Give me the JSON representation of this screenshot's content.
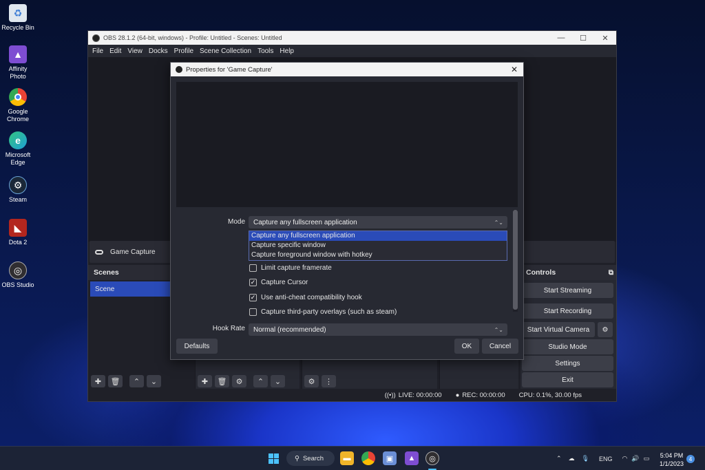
{
  "desktop": {
    "icons": [
      {
        "label": "Recycle Bin",
        "icon": "recycle-bin-icon",
        "color": "#dfe7ef"
      },
      {
        "label": "Affinity Photo",
        "icon": "affinity-photo-icon",
        "color": "#7e4dd2"
      },
      {
        "label": "Google Chrome",
        "icon": "chrome-icon",
        "color": "#e84335"
      },
      {
        "label": "Microsoft Edge",
        "icon": "edge-icon",
        "color": "#1fa0d6"
      },
      {
        "label": "Steam",
        "icon": "steam-icon",
        "color": "#1b2838"
      },
      {
        "label": "Dota 2",
        "icon": "dota2-icon",
        "color": "#b3261e"
      },
      {
        "label": "OBS Studio",
        "icon": "obs-icon",
        "color": "#302e31"
      }
    ]
  },
  "obs": {
    "title": "OBS 28.1.2 (64-bit, windows) - Profile: Untitled - Scenes: Untitled",
    "window_controls": {
      "minimize": "—",
      "maximize": "☐",
      "close": "✕"
    },
    "menu": [
      "File",
      "Edit",
      "View",
      "Docks",
      "Profile",
      "Scene Collection",
      "Tools",
      "Help"
    ],
    "source_name": "Game Capture",
    "scenes": {
      "header": "Scenes",
      "items": [
        "Scene"
      ]
    },
    "controls": {
      "header": "Controls",
      "start_streaming": "Start Streaming",
      "start_recording": "Start Recording",
      "start_virtual_camera": "Start Virtual Camera",
      "studio_mode": "Studio Mode",
      "settings": "Settings",
      "exit": "Exit"
    },
    "status": {
      "live": "LIVE: 00:00:00",
      "rec": "REC: 00:00:00",
      "cpu": "CPU: 0.1%, 30.00 fps"
    }
  },
  "dialog": {
    "title": "Properties for 'Game Capture'",
    "close": "✕",
    "mode_label": "Mode",
    "mode_value": "Capture any fullscreen application",
    "mode_options": [
      "Capture any fullscreen application",
      "Capture specific window",
      "Capture foreground window with hotkey"
    ],
    "checkboxes": [
      {
        "label": "Limit capture framerate",
        "checked": false
      },
      {
        "label": "Capture Cursor",
        "checked": true
      },
      {
        "label": "Use anti-cheat compatibility hook",
        "checked": true
      },
      {
        "label": "Capture third-party overlays (such as steam)",
        "checked": false
      }
    ],
    "hook_rate_label": "Hook Rate",
    "hook_rate_value": "Normal (recommended)",
    "defaults": "Defaults",
    "ok": "OK",
    "cancel": "Cancel"
  },
  "taskbar": {
    "search": "Search",
    "language": "ENG",
    "time": "5:04 PM",
    "date": "1/1/2023",
    "notifications": "4"
  },
  "colors": {
    "accent": "#2a4bb8",
    "panel": "#272932",
    "button": "#3c3e48"
  }
}
